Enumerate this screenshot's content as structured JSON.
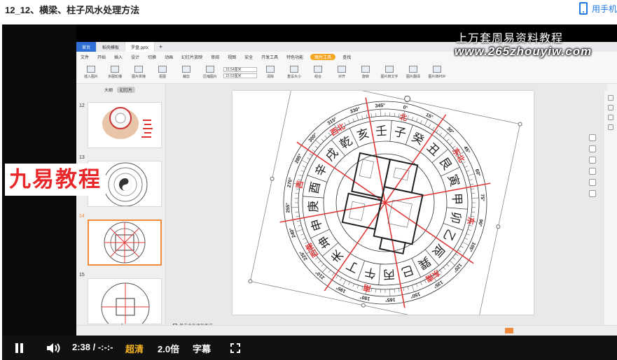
{
  "page": {
    "title": "12_12、横梁、柱子风水处理方法",
    "phone_link": "用手机"
  },
  "overlay": {
    "watermark_title": "上万套周易资料教程",
    "watermark_url": "www.265zhouyiw.com",
    "brand": "九易教程"
  },
  "app": {
    "tabs": [
      "首页",
      "稻壳模板",
      "罗盘.pptx"
    ],
    "menu": [
      "文件",
      "开始",
      "插入",
      "设计",
      "切换",
      "动画",
      "幻灯片放映",
      "审阅",
      "视图",
      "安全",
      "开发工具",
      "特色功能",
      "图片工具",
      "查找"
    ],
    "ribbon_buttons": [
      "插入图片",
      "多图轮播",
      "图片拼接",
      "抠图",
      "裁剪",
      "压缩图片",
      "清除",
      "重设大小",
      "组合",
      "对齐",
      "旋转",
      "图片转文字",
      "图片翻译",
      "图片转PDF"
    ],
    "ribbon_fields": [
      "15.54厘米",
      "15.53厘米"
    ],
    "thumb_tabs": [
      "大纲",
      "幻灯片"
    ],
    "thumb_numbers": [
      "12",
      "13",
      "14",
      "15"
    ],
    "add_slide": "+",
    "note_hint": "单击此处添加备注"
  },
  "compass": {
    "rings": {
      "mountains": [
        "子",
        "癸",
        "丑",
        "艮",
        "寅",
        "甲",
        "卯",
        "乙",
        "辰",
        "巽",
        "巳",
        "丙",
        "午",
        "丁",
        "未",
        "坤",
        "申",
        "庚",
        "酉",
        "辛",
        "戌",
        "乾",
        "亥",
        "壬"
      ],
      "directions": [
        "北",
        "东北",
        "东",
        "东南",
        "南",
        "西南",
        "西",
        "西北"
      ],
      "degrees": [
        "0°",
        "15°",
        "30°",
        "45°",
        "60°",
        "75°",
        "90°",
        "105°",
        "120°",
        "135°",
        "150°",
        "165°",
        "180°",
        "195°",
        "210°",
        "225°",
        "240°",
        "255°",
        "270°",
        "285°",
        "300°",
        "315°",
        "330°",
        "345°"
      ]
    },
    "colors": {
      "line": "#e03a3a",
      "ring": "#333333",
      "text": "#222222"
    }
  },
  "player": {
    "time": "2:38 / -:-:-",
    "quality": "超清",
    "speed": "2.0倍",
    "caption": "字幕"
  }
}
